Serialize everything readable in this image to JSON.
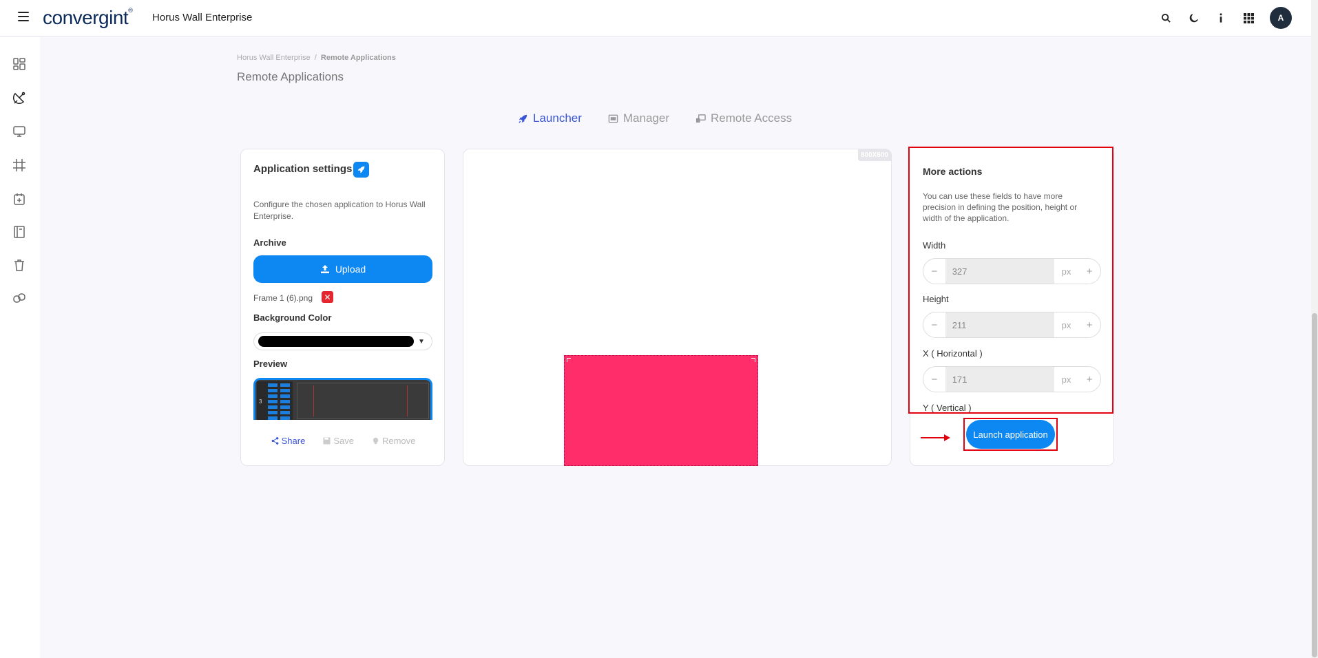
{
  "header": {
    "logo_text": "convergint",
    "logo_mark": "®",
    "app_title": "Horus Wall Enterprise",
    "avatar_initial": "A"
  },
  "icons": {
    "top": [
      "search-icon",
      "moon-icon",
      "info-icon",
      "apps-grid-icon"
    ],
    "sidebar": [
      "dashboard-icon",
      "satellite-icon",
      "monitor-icon",
      "crop-frame-icon",
      "calendar-plus-icon",
      "book-icon",
      "trash-icon",
      "copy-link-icon"
    ]
  },
  "breadcrumb": {
    "root": "Horus Wall Enterprise",
    "separator": "/",
    "current": "Remote Applications"
  },
  "page": {
    "title": "Remote Applications"
  },
  "tabs": [
    {
      "label": "Launcher",
      "active": true
    },
    {
      "label": "Manager",
      "active": false
    },
    {
      "label": "Remote Access",
      "active": false
    }
  ],
  "settings": {
    "title": "Application settings",
    "description": "Configure the chosen application to Horus Wall Enterprise.",
    "archive_label": "Archive",
    "upload_label": "Upload",
    "file_name": "Frame 1 (6).png",
    "remove_file_glyph": "✕",
    "background_label": "Background Color",
    "background_value": "#000000",
    "caret": "▼",
    "preview_label": "Preview",
    "preview_number": "3",
    "actions": {
      "share": "Share",
      "save": "Save",
      "remove": "Remove"
    }
  },
  "canvas": {
    "resolution": "800X600",
    "app_color": "#ff2d6a"
  },
  "more_actions": {
    "title": "More actions",
    "description": "You can use these fields to have more precision in defining the position, height or width of the application.",
    "unit": "px",
    "minus": "−",
    "plus": "+",
    "fields": [
      {
        "label": "Width",
        "value": "327"
      },
      {
        "label": "Height",
        "value": "211"
      },
      {
        "label": "X ( Horizontal )",
        "value": "171"
      },
      {
        "label": "Y ( Vertical )",
        "value": ""
      }
    ]
  },
  "launch": {
    "label": "Launch application"
  },
  "colors": {
    "primary": "#0d87f2",
    "accent_tab": "#3a56d4",
    "highlight": "#e3000f",
    "danger": "#e4262f"
  }
}
